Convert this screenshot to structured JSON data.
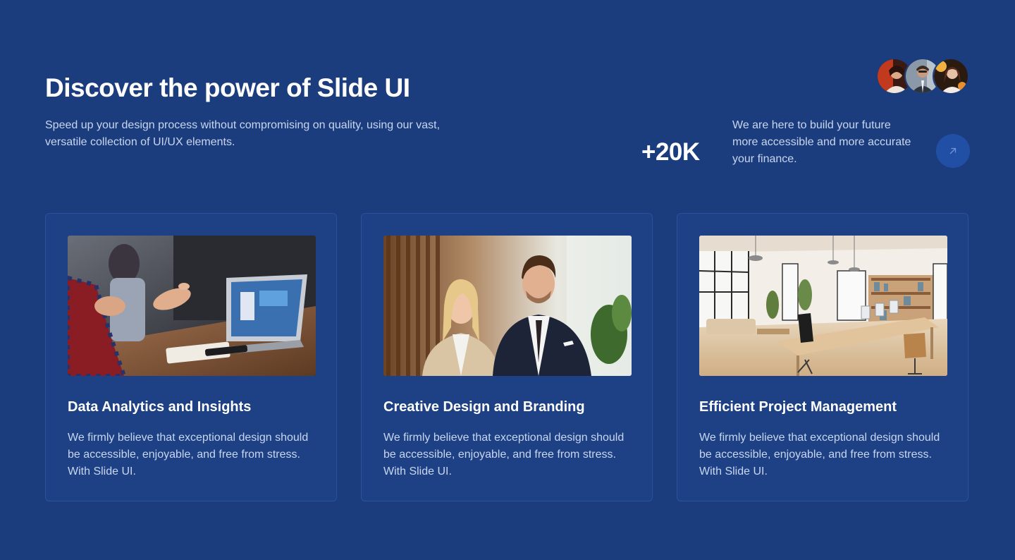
{
  "hero": {
    "title": "Discover the power of Slide UI",
    "subtitle": "Speed up your design process without compromising on quality, using our vast, versatile collection of UI/UX elements."
  },
  "stats": {
    "value": "+20K",
    "description": "We are here to build your future more accessible and more accurate your finance.",
    "button_icon": "arrow-up-right-icon"
  },
  "colors": {
    "background": "#1b3d7e",
    "card_background": "#1d4184",
    "card_border": "#2c519a",
    "button": "#224fa6",
    "muted_text": "#c9d6f0"
  },
  "cards": [
    {
      "title": "Data Analytics and Insights",
      "text": "We firmly believe that exceptional design should be accessible, enjoyable, and free from stress. With Slide UI."
    },
    {
      "title": "Creative Design and Branding",
      "text": "We firmly believe that exceptional design should be accessible, enjoyable, and free from stress. With Slide UI."
    },
    {
      "title": "Efficient Project Management",
      "text": "We firmly believe that exceptional design should be accessible, enjoyable, and free from stress. With Slide UI."
    }
  ]
}
